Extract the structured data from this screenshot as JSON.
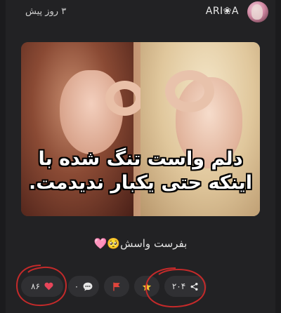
{
  "post": {
    "time_ago": "۳ روز پیش",
    "author": "ARI❀A",
    "caption_line1": "دلم واست تنگ شده با",
    "caption_line2": "اینکه حتی یکبار ندیدمت.",
    "body_text": "بفرست واسش🥺🩷"
  },
  "actions": {
    "likes": "۸۶",
    "comments": "۰",
    "shares": "۲۰۴"
  },
  "colors": {
    "heart": "#e8455a",
    "flag": "#e0453c",
    "star": "#f2c230",
    "annotation": "#c42a2a"
  }
}
